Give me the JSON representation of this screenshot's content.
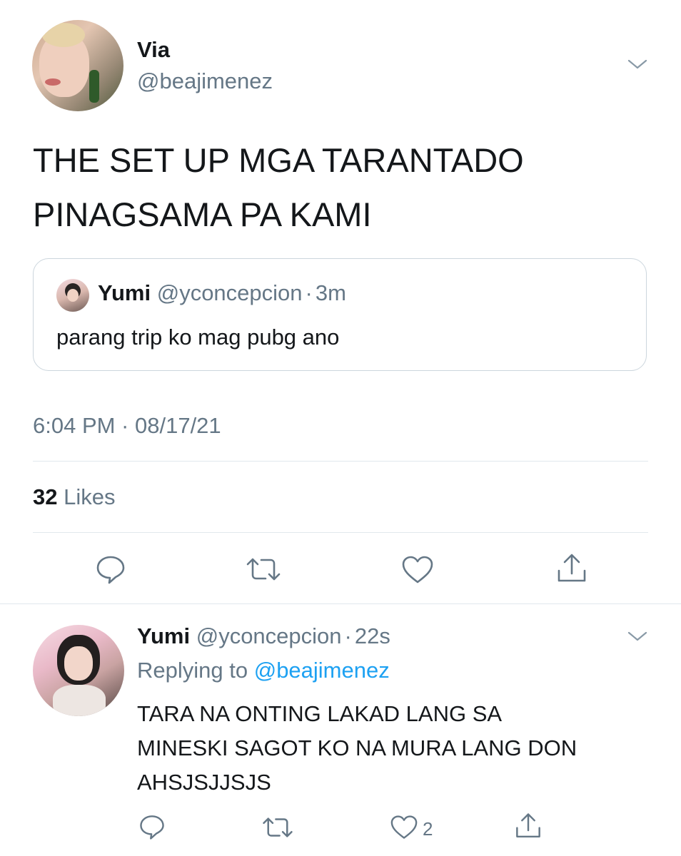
{
  "main_tweet": {
    "display_name": "Via",
    "handle": "@beajimenez",
    "text_line1": "THE SET UP MGA TARANTADO",
    "text_line2": "PINAGSAMA PA KAMI",
    "quoted": {
      "display_name": "Yumi",
      "handle": "@yconcepcion",
      "separator": "·",
      "time": "3m",
      "text": "parang trip ko mag pubg ano"
    },
    "timestamp": "6:04 PM · 08/17/21",
    "likes_count": "32",
    "likes_label": "Likes"
  },
  "reply": {
    "display_name": "Yumi",
    "handle": "@yconcepcion",
    "separator": "·",
    "time": "22s",
    "replying_to_label": "Replying to",
    "replying_to_handle": "@beajimenez",
    "text_line1": "TARA NA ONTING LAKAD LANG SA",
    "text_line2": "MINESKI SAGOT KO NA MURA LANG DON",
    "text_line3": "AHSJSJJSJS",
    "like_count": "2"
  },
  "colors": {
    "text": "#14171a",
    "muted": "#657786",
    "link": "#1da1f2",
    "divider": "#e1e8ed"
  }
}
